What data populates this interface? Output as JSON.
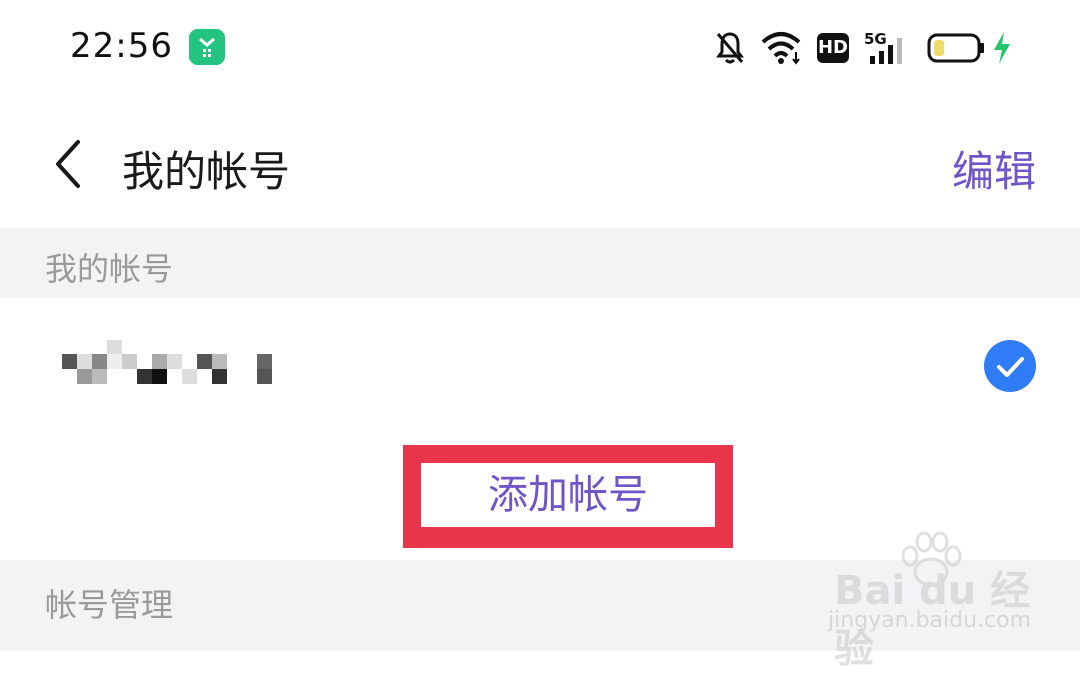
{
  "status_bar": {
    "time": "22:56",
    "hd": "HD",
    "network": "5G"
  },
  "nav": {
    "title": "我的帐号",
    "edit_label": "编辑"
  },
  "sections": {
    "my_accounts": "我的帐号",
    "account_management": "帐号管理"
  },
  "add_account_label": "添加帐号",
  "watermark": {
    "logo": "Bai du 经验",
    "url": "jingyan.baidu.com"
  },
  "colors": {
    "accent": "#6f55c8",
    "check": "#2f7cf6",
    "highlight_border": "#e8354a",
    "section_bg": "#f3f3f5"
  }
}
